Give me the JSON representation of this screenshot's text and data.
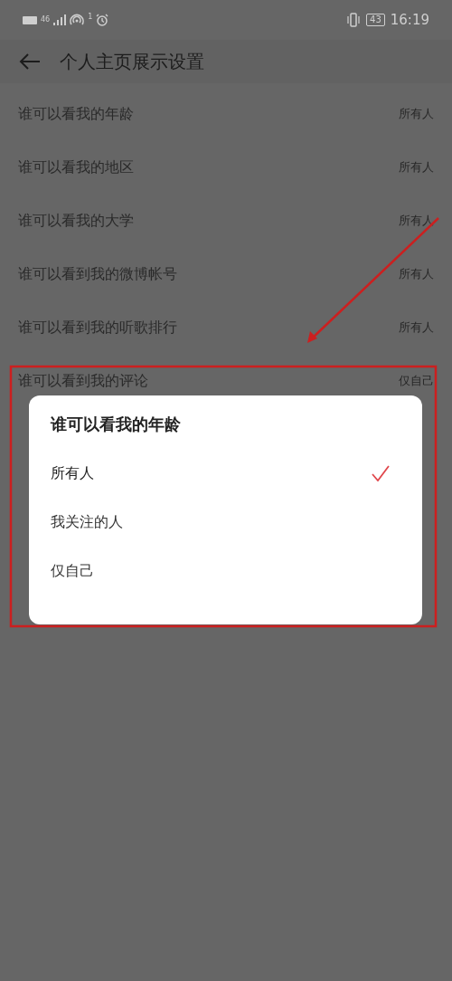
{
  "status_bar": {
    "network": "46",
    "hotspot_badge": "1",
    "battery": "43",
    "time": "16:19"
  },
  "header": {
    "title": "个人主页展示设置"
  },
  "settings": [
    {
      "label": "谁可以看我的年龄",
      "value": "所有人"
    },
    {
      "label": "谁可以看我的地区",
      "value": "所有人"
    },
    {
      "label": "谁可以看我的大学",
      "value": "所有人"
    },
    {
      "label": "谁可以看到我的微博帐号",
      "value": "所有人"
    },
    {
      "label": "谁可以看到我的听歌排行",
      "value": "所有人"
    },
    {
      "label": "谁可以看到我的评论",
      "value": "仅自己"
    }
  ],
  "dialog": {
    "title": "谁可以看我的年龄",
    "options": [
      {
        "label": "所有人",
        "selected": true
      },
      {
        "label": "我关注的人",
        "selected": false
      },
      {
        "label": "仅自己",
        "selected": false
      }
    ]
  }
}
